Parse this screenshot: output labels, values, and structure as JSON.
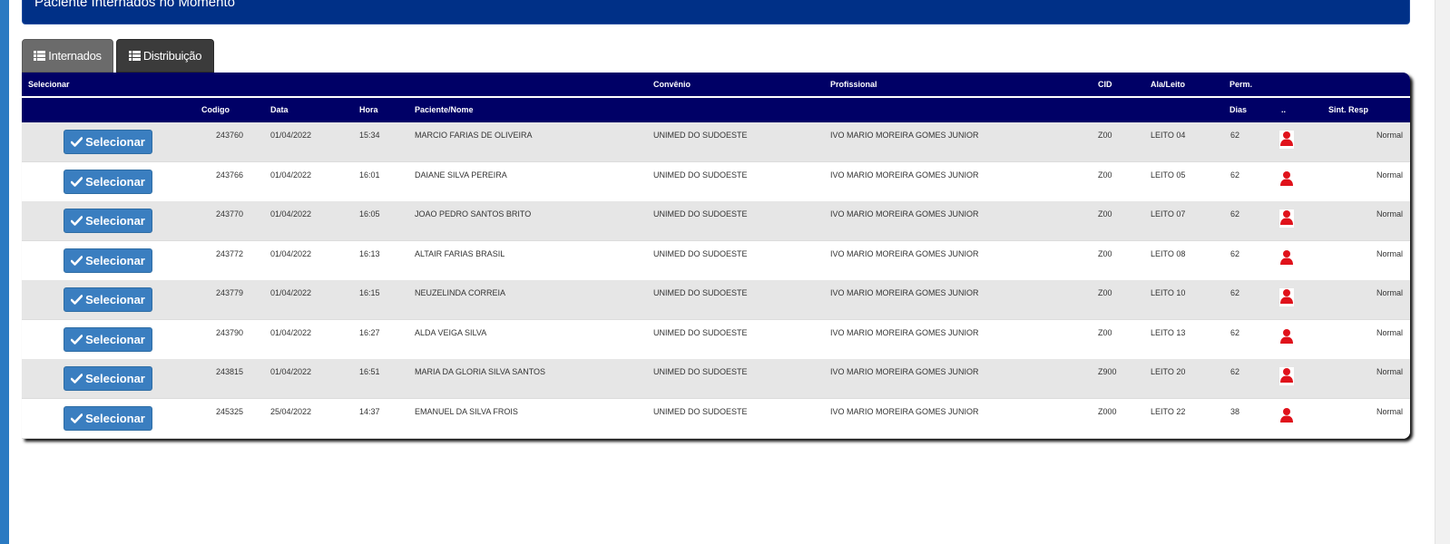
{
  "header": {
    "title": "Paciente Internados no Momento"
  },
  "tabs": [
    {
      "label": "Internados",
      "icon": "list-icon"
    },
    {
      "label": "Distribuição",
      "icon": "list-icon"
    }
  ],
  "table": {
    "header_row1": {
      "selecionar": "Selecionar",
      "convenio": "Convênio",
      "profissional": "Profissional",
      "cid": "CID",
      "ala_leito": "Ala/Leito",
      "perm": "Perm."
    },
    "header_row2": {
      "codigo": "Codigo",
      "data": "Data",
      "hora": "Hora",
      "paciente": "Paciente/Nome",
      "dias": "Dias",
      "dots": "..",
      "sint_resp": "Sint. Resp"
    },
    "select_label": "Selecionar",
    "rows": [
      {
        "codigo": "243760",
        "data": "01/04/2022",
        "hora": "15:34",
        "paciente": "MARCIO FARIAS DE OLIVEIRA",
        "convenio": "UNIMED DO SUDOESTE",
        "profissional": "IVO MARIO MOREIRA GOMES JUNIOR",
        "cid": "Z00",
        "leito": "LEITO 04",
        "dias": "62",
        "sint": "Normal"
      },
      {
        "codigo": "243766",
        "data": "01/04/2022",
        "hora": "16:01",
        "paciente": "DAIANE SILVA PEREIRA",
        "convenio": "UNIMED DO SUDOESTE",
        "profissional": "IVO MARIO MOREIRA GOMES JUNIOR",
        "cid": "Z00",
        "leito": "LEITO 05",
        "dias": "62",
        "sint": "Normal"
      },
      {
        "codigo": "243770",
        "data": "01/04/2022",
        "hora": "16:05",
        "paciente": "JOAO PEDRO SANTOS BRITO",
        "convenio": "UNIMED DO SUDOESTE",
        "profissional": "IVO MARIO MOREIRA GOMES JUNIOR",
        "cid": "Z00",
        "leito": "LEITO 07",
        "dias": "62",
        "sint": "Normal"
      },
      {
        "codigo": "243772",
        "data": "01/04/2022",
        "hora": "16:13",
        "paciente": "ALTAIR FARIAS BRASIL",
        "convenio": "UNIMED DO SUDOESTE",
        "profissional": "IVO MARIO MOREIRA GOMES JUNIOR",
        "cid": "Z00",
        "leito": "LEITO 08",
        "dias": "62",
        "sint": "Normal"
      },
      {
        "codigo": "243779",
        "data": "01/04/2022",
        "hora": "16:15",
        "paciente": "NEUZELINDA CORREIA",
        "convenio": "UNIMED DO SUDOESTE",
        "profissional": "IVO MARIO MOREIRA GOMES JUNIOR",
        "cid": "Z00",
        "leito": "LEITO 10",
        "dias": "62",
        "sint": "Normal"
      },
      {
        "codigo": "243790",
        "data": "01/04/2022",
        "hora": "16:27",
        "paciente": "ALDA VEIGA SILVA",
        "convenio": "UNIMED DO SUDOESTE",
        "profissional": "IVO MARIO MOREIRA GOMES JUNIOR",
        "cid": "Z00",
        "leito": "LEITO 13",
        "dias": "62",
        "sint": "Normal"
      },
      {
        "codigo": "243815",
        "data": "01/04/2022",
        "hora": "16:51",
        "paciente": "MARIA DA GLORIA SILVA SANTOS",
        "convenio": "UNIMED DO SUDOESTE",
        "profissional": "IVO MARIO MOREIRA GOMES JUNIOR",
        "cid": "Z900",
        "leito": "LEITO 20",
        "dias": "62",
        "sint": "Normal"
      },
      {
        "codigo": "245325",
        "data": "25/04/2022",
        "hora": "14:37",
        "paciente": "EMANUEL DA SILVA FROIS",
        "convenio": "UNIMED DO SUDOESTE",
        "profissional": "IVO MARIO MOREIRA GOMES JUNIOR",
        "cid": "Z000",
        "leito": "LEITO 22",
        "dias": "38",
        "sint": "Normal"
      }
    ]
  },
  "colors": {
    "header_bg": "#003087",
    "table_header_bg": "#000066",
    "button_bg": "#3a7ec0",
    "person_icon": "#e0121b"
  }
}
